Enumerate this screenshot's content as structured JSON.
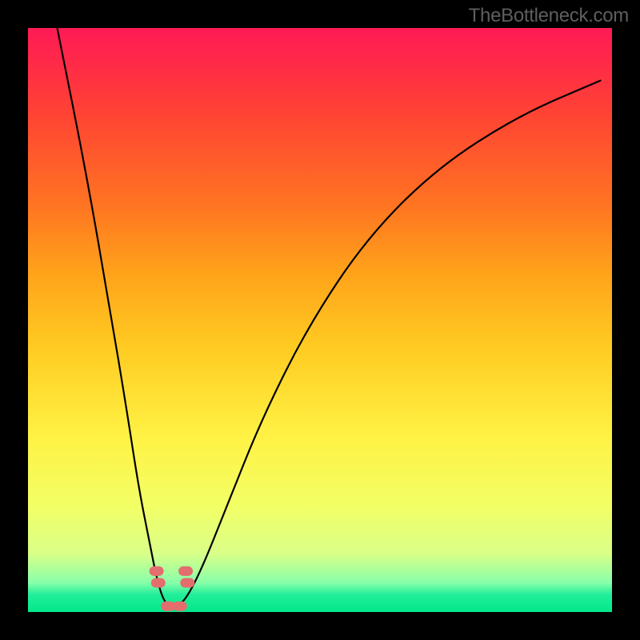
{
  "watermark": "TheBottleneck.com",
  "chart_data": {
    "type": "line",
    "title": "",
    "xlabel": "",
    "ylabel": "",
    "xlim": [
      0,
      100
    ],
    "ylim": [
      0,
      100
    ],
    "grid": false,
    "legend": false,
    "series": [
      {
        "name": "bottleneck-curve",
        "x": [
          5,
          10,
          14,
          17,
          19,
          21,
          22,
          23,
          24,
          25,
          26,
          27.5,
          30,
          34,
          40,
          48,
          58,
          70,
          84,
          98
        ],
        "values": [
          100,
          75,
          52,
          34,
          21,
          11,
          6,
          2.5,
          1,
          0.8,
          1.2,
          3,
          8,
          18,
          33,
          49,
          64,
          76,
          85,
          91
        ]
      }
    ],
    "markers": [
      {
        "name": "left-cluster-top",
        "x": 22.0,
        "value": 7.0
      },
      {
        "name": "left-cluster-bottom",
        "x": 22.3,
        "value": 5.0
      },
      {
        "name": "right-cluster-top",
        "x": 27.0,
        "value": 7.0
      },
      {
        "name": "right-cluster-bottom",
        "x": 27.3,
        "value": 5.0
      },
      {
        "name": "bottom-pill-left",
        "x": 24.0,
        "value": 1.0
      },
      {
        "name": "bottom-pill-right",
        "x": 26.0,
        "value": 1.0
      }
    ],
    "gradient_stops": [
      {
        "pos": 0,
        "color": "#ff1a55"
      },
      {
        "pos": 50,
        "color": "#ffd040"
      },
      {
        "pos": 80,
        "color": "#fffe55"
      },
      {
        "pos": 100,
        "color": "#00e88a"
      }
    ]
  }
}
